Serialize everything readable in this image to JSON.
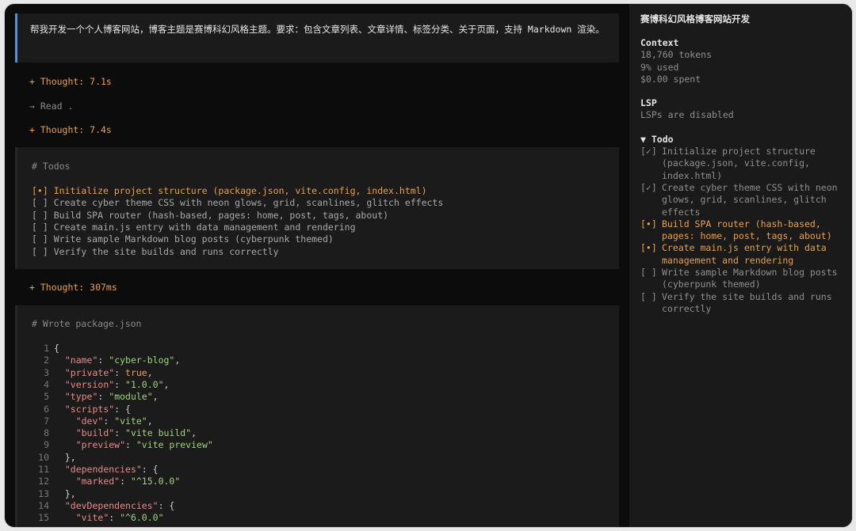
{
  "prompt": "帮我开发一个个人博客网站，博客主题是赛博科幻风格主题。要求：包含文章列表、文章详情、标签分类、关于页面，支持 Markdown 渲染。",
  "timeline": {
    "thought1": "+ Thought: 7.1s",
    "read": "→ Read .",
    "thought2": "+ Thought: 7.4s",
    "thought3": "+ Thought: 307ms"
  },
  "todos_panel": {
    "heading": "# Todos",
    "items": [
      {
        "box": "[•]",
        "label": "Initialize project structure (package.json, vite.config, index.html)",
        "state": "active"
      },
      {
        "box": "[ ]",
        "label": "Create cyber theme CSS with neon glows, grid, scanlines, glitch effects",
        "state": "pending"
      },
      {
        "box": "[ ]",
        "label": "Build SPA router (hash-based, pages: home, post, tags, about)",
        "state": "pending"
      },
      {
        "box": "[ ]",
        "label": "Create main.js entry with data management and rendering",
        "state": "pending"
      },
      {
        "box": "[ ]",
        "label": "Write sample Markdown blog posts (cyberpunk themed)",
        "state": "pending"
      },
      {
        "box": "[ ]",
        "label": "Verify the site builds and runs correctly",
        "state": "pending"
      }
    ]
  },
  "code_panel": {
    "heading": "# Wrote package.json",
    "lines": [
      {
        "n": "1",
        "t": [
          [
            "p",
            "{"
          ]
        ]
      },
      {
        "n": "2",
        "t": [
          [
            "p",
            "  "
          ],
          [
            "k",
            "\"name\""
          ],
          [
            "p",
            ": "
          ],
          [
            "s",
            "\"cyber-blog\""
          ],
          [
            "p",
            ","
          ]
        ]
      },
      {
        "n": "3",
        "t": [
          [
            "p",
            "  "
          ],
          [
            "k",
            "\"private\""
          ],
          [
            "p",
            ": "
          ],
          [
            "b",
            "true"
          ],
          [
            "p",
            ","
          ]
        ]
      },
      {
        "n": "4",
        "t": [
          [
            "p",
            "  "
          ],
          [
            "k",
            "\"version\""
          ],
          [
            "p",
            ": "
          ],
          [
            "s",
            "\"1.0.0\""
          ],
          [
            "p",
            ","
          ]
        ]
      },
      {
        "n": "5",
        "t": [
          [
            "p",
            "  "
          ],
          [
            "k",
            "\"type\""
          ],
          [
            "p",
            ": "
          ],
          [
            "s",
            "\"module\""
          ],
          [
            "p",
            ","
          ]
        ]
      },
      {
        "n": "6",
        "t": [
          [
            "p",
            "  "
          ],
          [
            "k",
            "\"scripts\""
          ],
          [
            "p",
            ": {"
          ]
        ]
      },
      {
        "n": "7",
        "t": [
          [
            "p",
            "    "
          ],
          [
            "k",
            "\"dev\""
          ],
          [
            "p",
            ": "
          ],
          [
            "s",
            "\"vite\""
          ],
          [
            "p",
            ","
          ]
        ]
      },
      {
        "n": "8",
        "t": [
          [
            "p",
            "    "
          ],
          [
            "k",
            "\"build\""
          ],
          [
            "p",
            ": "
          ],
          [
            "s",
            "\"vite build\""
          ],
          [
            "p",
            ","
          ]
        ]
      },
      {
        "n": "9",
        "t": [
          [
            "p",
            "    "
          ],
          [
            "k",
            "\"preview\""
          ],
          [
            "p",
            ": "
          ],
          [
            "s",
            "\"vite preview\""
          ]
        ]
      },
      {
        "n": "10",
        "t": [
          [
            "p",
            "  },"
          ]
        ]
      },
      {
        "n": "11",
        "t": [
          [
            "p",
            "  "
          ],
          [
            "k",
            "\"dependencies\""
          ],
          [
            "p",
            ": {"
          ]
        ]
      },
      {
        "n": "12",
        "t": [
          [
            "p",
            "    "
          ],
          [
            "k",
            "\"marked\""
          ],
          [
            "p",
            ": "
          ],
          [
            "s",
            "\"^15.0.0\""
          ]
        ]
      },
      {
        "n": "13",
        "t": [
          [
            "p",
            "  },"
          ]
        ]
      },
      {
        "n": "14",
        "t": [
          [
            "p",
            "  "
          ],
          [
            "k",
            "\"devDependencies\""
          ],
          [
            "p",
            ": {"
          ]
        ]
      },
      {
        "n": "15",
        "t": [
          [
            "p",
            "    "
          ],
          [
            "k",
            "\"vite\""
          ],
          [
            "p",
            ": "
          ],
          [
            "s",
            "\"^6.0.0\""
          ]
        ]
      }
    ]
  },
  "sidebar": {
    "title": "赛博科幻风格博客网站开发",
    "context": {
      "heading": "Context",
      "tokens": "18,760 tokens",
      "used": "9% used",
      "spent": "$0.00 spent"
    },
    "lsp": {
      "heading": "LSP",
      "status": "LSPs are disabled"
    },
    "todo": {
      "heading": "▼ Todo",
      "items": [
        {
          "box": "[✓]",
          "label": "Initialize project structure (package.json, vite.config, index.html)",
          "state": "done"
        },
        {
          "box": "[✓]",
          "label": "Create cyber theme CSS with neon glows, grid, scanlines, glitch effects",
          "state": "done"
        },
        {
          "box": "[•]",
          "label": "Build SPA router (hash-based, pages: home, post, tags, about)",
          "state": "active"
        },
        {
          "box": "[•]",
          "label": "Create main.js entry with data management and rendering",
          "state": "active"
        },
        {
          "box": "[ ]",
          "label": "Write sample Markdown blog posts (cyberpunk themed)",
          "state": "pending"
        },
        {
          "box": "[ ]",
          "label": "Verify the site builds and runs correctly",
          "state": "pending"
        }
      ]
    }
  },
  "colors": {
    "accent": "#e8a04d",
    "prompt_border": "#5b8fd1",
    "key": "#e98a8a",
    "string": "#9fd37f"
  }
}
